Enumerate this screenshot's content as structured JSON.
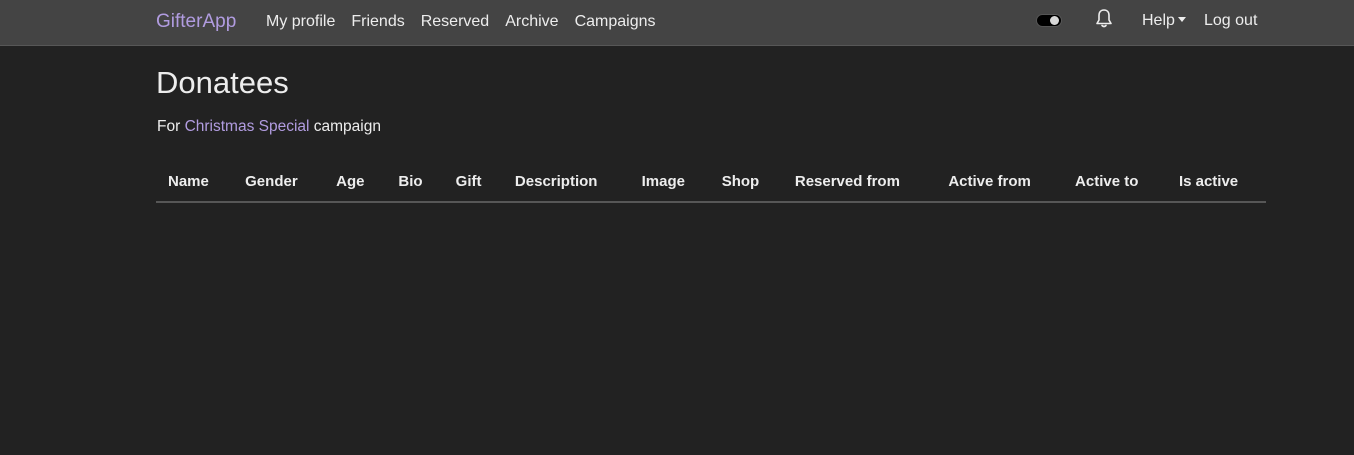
{
  "navbar": {
    "brand": "GifterApp",
    "links": [
      "My profile",
      "Friends",
      "Reserved",
      "Archive",
      "Campaigns"
    ],
    "help_label": "Help",
    "logout_label": "Log out",
    "icons": {
      "theme_toggle": "theme-toggle-icon",
      "notifications": "bell-icon"
    }
  },
  "main": {
    "title": "Donatees",
    "subtitle_prefix": "For ",
    "campaign_name": "Christmas Special",
    "subtitle_suffix": " campaign"
  },
  "table": {
    "columns": [
      "Name",
      "Gender",
      "Age",
      "Bio",
      "Gift",
      "Description",
      "Image",
      "Shop",
      "Reserved from",
      "Active from",
      "Active to",
      "Is active"
    ],
    "rows": []
  },
  "colors": {
    "background": "#222222",
    "navbar": "#444444",
    "accent": "#b19ce0",
    "text": "#ededed"
  }
}
